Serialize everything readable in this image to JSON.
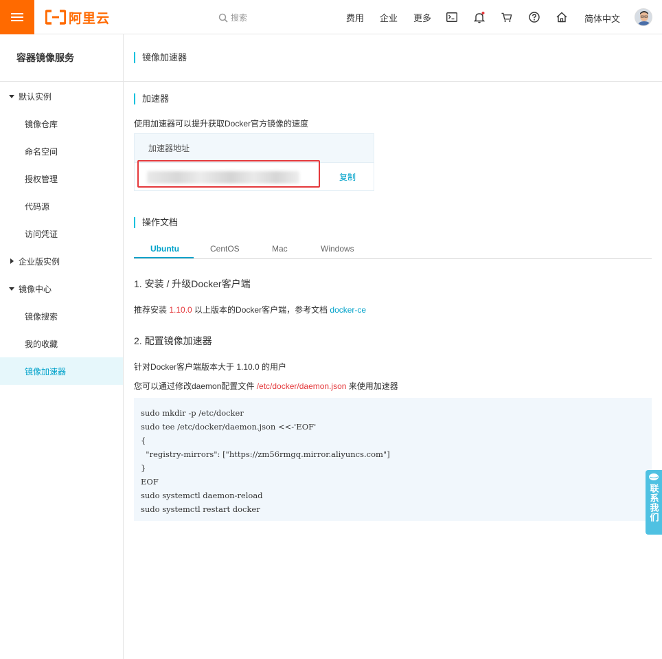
{
  "topbar": {
    "brand": "阿里云",
    "search_placeholder": "搜索",
    "links": [
      "费用",
      "企业",
      "更多"
    ],
    "language": "简体中文",
    "colors": {
      "brand": "#ff6a00"
    }
  },
  "sidebar": {
    "title": "容器镜像服务",
    "groups": [
      {
        "label": "默认实例",
        "expanded": true,
        "items": [
          "镜像仓库",
          "命名空间",
          "授权管理",
          "代码源",
          "访问凭证"
        ]
      },
      {
        "label": "企业版实例",
        "expanded": false,
        "items": []
      },
      {
        "label": "镜像中心",
        "expanded": true,
        "items": [
          "镜像搜索",
          "我的收藏",
          "镜像加速器"
        ]
      }
    ],
    "active_item": "镜像加速器"
  },
  "main": {
    "page_title": "镜像加速器",
    "accelerator": {
      "section_title": "加速器",
      "description": "使用加速器可以提升获取Docker官方镜像的速度",
      "table_header": "加速器地址",
      "copy_label": "复制"
    },
    "docs": {
      "section_title": "操作文档",
      "tabs": [
        "Ubuntu",
        "CentOS",
        "Mac",
        "Windows"
      ],
      "active_tab": "Ubuntu",
      "step1": {
        "heading": "1. 安装 / 升级Docker客户端",
        "text_before": "推荐安装 ",
        "version": "1.10.0",
        "text_middle": " 以上版本的Docker客户端，参考文档 ",
        "link": "docker-ce"
      },
      "step2": {
        "heading": "2. 配置镜像加速器",
        "line1": "针对Docker客户端版本大于 1.10.0 的用户",
        "line2_before": "您可以通过修改daemon配置文件 ",
        "line2_path": "/etc/docker/daemon.json",
        "line2_after": " 来使用加速器",
        "code": "sudo mkdir -p /etc/docker\nsudo tee /etc/docker/daemon.json <<-'EOF'\n{\n  \"registry-mirrors\": [\"https://zm56rmgq.mirror.aliyuncs.com\"]\n}\nEOF\nsudo systemctl daemon-reload\nsudo systemctl restart docker"
      }
    }
  },
  "contact": {
    "label": "联系我们"
  }
}
